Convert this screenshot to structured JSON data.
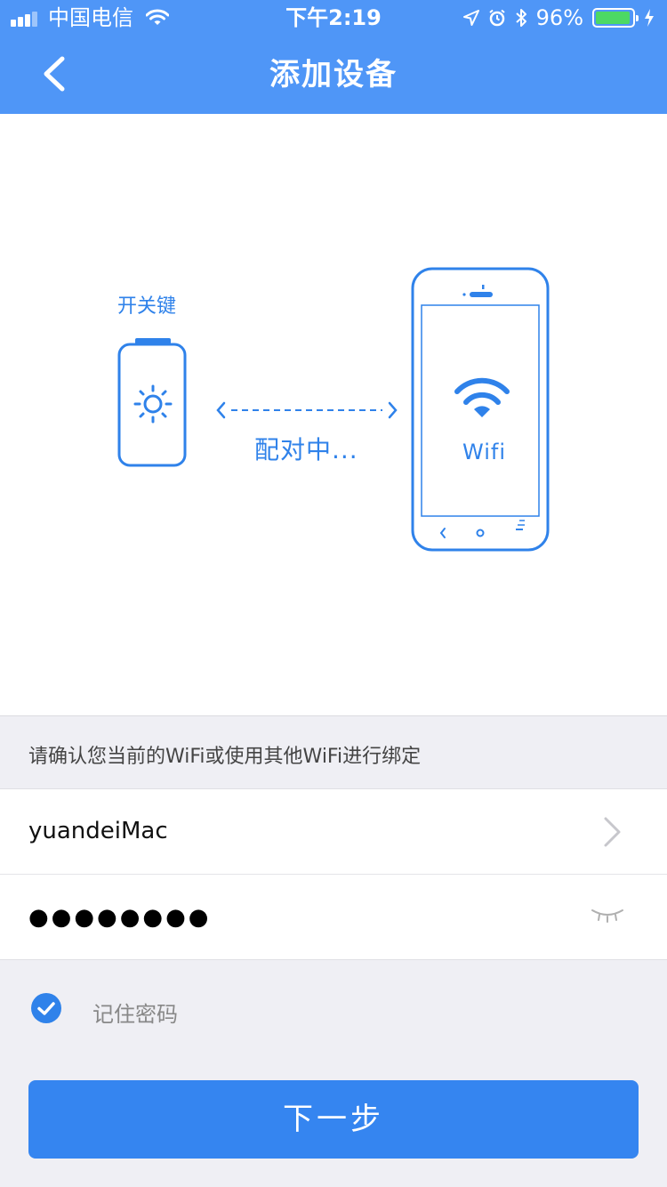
{
  "status_bar": {
    "carrier": "中国电信",
    "time": "下午2:19",
    "battery_percent": "96%"
  },
  "header": {
    "title": "添加设备"
  },
  "illustration": {
    "switch_label": "开关键",
    "pairing_status": "配对中...",
    "wifi_label": "Wifi"
  },
  "form": {
    "hint": "请确认您当前的WiFi或使用其他WiFi进行绑定",
    "ssid": "yuandeiMac",
    "password_masked": "●●●●●●●●",
    "remember_label": "记住密码",
    "remember_checked": true
  },
  "actions": {
    "next_label": "下一步"
  },
  "colors": {
    "header": "#4f96f7",
    "accent": "#2f82ea",
    "button": "#3585f0",
    "battery": "#4cd964"
  }
}
